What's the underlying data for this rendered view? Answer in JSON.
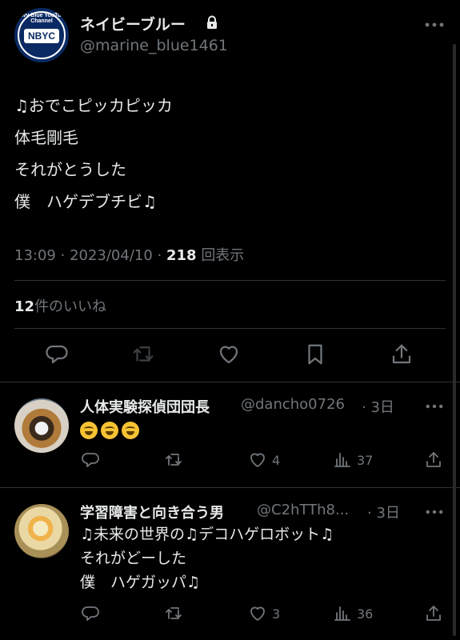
{
  "main_tweet": {
    "display_name": "ネイビーブルー",
    "handle": "@marine_blue1461",
    "avatar_logo": "NBYC",
    "avatar_ring_text": "Navy Blue YouTube Channel",
    "body_lines": [
      "♫おでこピッカピッカ",
      "体毛剛毛",
      "それがとうした",
      "僕　ハゲデブチビ♫"
    ],
    "time": "13:09",
    "date": "2023/04/10",
    "views_count": "218",
    "views_label": "回表示",
    "likes_count": "12",
    "likes_label": "件のいいね"
  },
  "replies": [
    {
      "display_name": "人体実験探偵団団長",
      "handle": "@dancho0726",
      "time": "3日",
      "emoji_count": 3,
      "body_lines": [],
      "reply_count": "",
      "retweet_count": "",
      "like_count": "4",
      "view_count": "37"
    },
    {
      "display_name": "学習障害と向き合う男",
      "handle": "@C2hTTh8...",
      "time": "3日",
      "body_lines": [
        "♫未来の世界の♫デコハゲロボット♫",
        "それがどーした",
        "僕　ハゲガッパ♫"
      ],
      "reply_count": "",
      "retweet_count": "",
      "like_count": "3",
      "view_count": "36"
    }
  ],
  "icons": [
    "lock-icon",
    "more-icon",
    "reply-icon",
    "retweet-icon",
    "like-icon",
    "bookmark-icon",
    "share-icon",
    "views-icon"
  ],
  "colors": {
    "background": "#000000",
    "text": "#e7e9ea",
    "muted": "#71767b",
    "divider": "#2f3336"
  }
}
